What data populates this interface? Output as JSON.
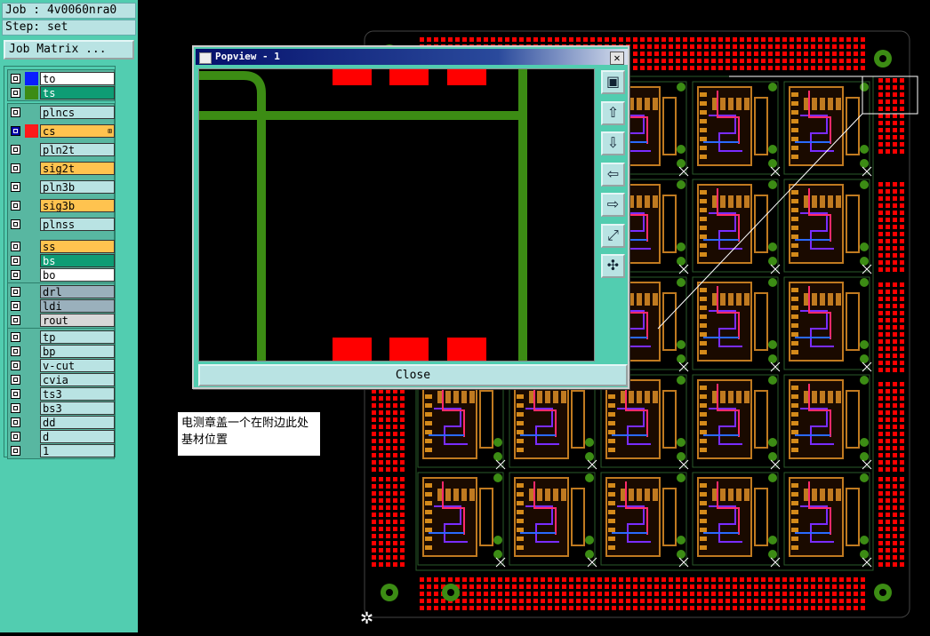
{
  "header": {
    "job": "Job : 4v0060nra0",
    "step": "Step: set",
    "job_matrix_label": "Job Matrix ..."
  },
  "layers": [
    {
      "name": "to",
      "color": "#ffffff",
      "swatch": "#0a1eff"
    },
    {
      "name": "ts",
      "color": "#0e9c74",
      "swatch": "#3c8c14",
      "text_color": "#ffffff"
    },
    {
      "name": "plncs",
      "color": "#b9e3e3"
    },
    {
      "name": "cs",
      "color": "#ffc34f",
      "swatch": "#ff1a1a",
      "selected": true,
      "plus": "⊞"
    },
    {
      "name": "pln2t",
      "color": "#b9e3e3"
    },
    {
      "name": "sig2t",
      "color": "#ffc34f"
    },
    {
      "name": "pln3b",
      "color": "#b9e3e3"
    },
    {
      "name": "sig3b",
      "color": "#ffc34f"
    },
    {
      "name": "plnss",
      "color": "#b9e3e3"
    },
    {
      "name": "ss",
      "color": "#ffc34f"
    },
    {
      "name": "bs",
      "color": "#0e9c74",
      "text_color": "#ffffff"
    },
    {
      "name": "bo",
      "color": "#ffffff"
    },
    {
      "name": "drl",
      "color": "#9ab0bc"
    },
    {
      "name": "ldi",
      "color": "#9ab0bc"
    },
    {
      "name": "rout",
      "color": "#d8d8d8"
    },
    {
      "name": "tp",
      "color": "#b9e3e3"
    },
    {
      "name": "bp",
      "color": "#b9e3e3"
    },
    {
      "name": "v-cut",
      "color": "#b9e3e3"
    },
    {
      "name": "cvia",
      "color": "#b9e3e3"
    },
    {
      "name": "ts3",
      "color": "#b9e3e3"
    },
    {
      "name": "bs3",
      "color": "#b9e3e3"
    },
    {
      "name": "dd",
      "color": "#b9e3e3"
    },
    {
      "name": "d",
      "color": "#b9e3e3"
    },
    {
      "name": "1",
      "color": "#b9e3e3"
    }
  ],
  "popup": {
    "title": "Popview - 1",
    "close_x": "✕",
    "close_label": "Close",
    "tools": [
      "zoom-window-icon",
      "pan-up-icon",
      "pan-down-icon",
      "pan-left-icon",
      "pan-right-icon",
      "zoom-fit-icon",
      "zoom-out-icon"
    ]
  },
  "note": {
    "line1": "电测章盖一个在附边此处",
    "line2": "基材位置"
  },
  "colors": {
    "pad_red": "#ff0000",
    "trace_green": "#3c8c14",
    "panel": "#52cdb0",
    "button": "#b9e3e3"
  }
}
